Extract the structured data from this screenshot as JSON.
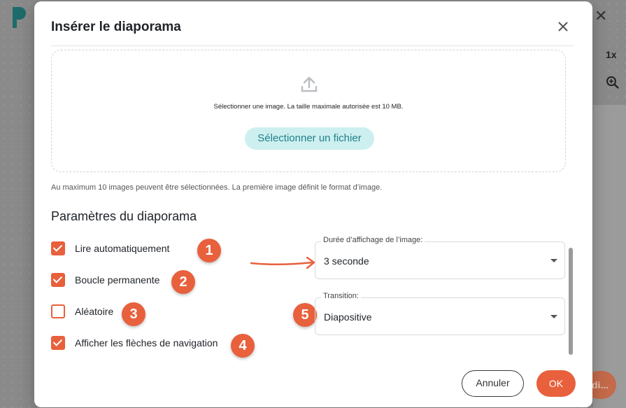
{
  "background": {
    "zoom_label": "1x",
    "action_button_label": "di..."
  },
  "dialog": {
    "title": "Insérer le diaporama",
    "upload": {
      "instruction": "Sélectionner une image. La taille maximale autorisée est 10 MB.",
      "button_label": "Sélectionner un fichier"
    },
    "hint": "Au maximum 10 images peuvent être sélectionnées. La première image définit le format d’image.",
    "settings_title": "Paramètres du diaporama",
    "options": [
      {
        "label": "Lire automatiquement",
        "checked": true,
        "badge": "1"
      },
      {
        "label": "Boucle permanente",
        "checked": true,
        "badge": "2"
      },
      {
        "label": "Aléatoire",
        "checked": false,
        "badge": "3"
      },
      {
        "label": "Afficher les flèches de navigation",
        "checked": true,
        "badge": "4"
      }
    ],
    "duration": {
      "legend": "Durée d’affichage de l’image:",
      "value": "3 seconde"
    },
    "transition": {
      "legend": "Transition:",
      "value": "Diapositive",
      "badge": "5"
    },
    "cancel_label": "Annuler",
    "ok_label": "OK"
  },
  "colors": {
    "accent": "#e8603c",
    "file_button_bg": "#cdeff0",
    "file_button_text": "#21808a"
  },
  "icons": [
    "close-icon",
    "upload-icon",
    "zoom-in-icon",
    "app-logo"
  ]
}
